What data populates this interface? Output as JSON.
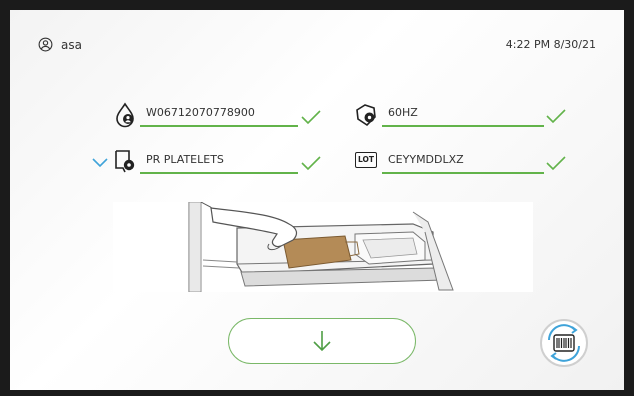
{
  "user": {
    "name": "asa",
    "icon": "user-circle-icon"
  },
  "clock": {
    "datetime": "4:22 PM 8/30/21"
  },
  "fields": {
    "donation_id": {
      "value": "W06712070778900",
      "icon": "donor-drop-icon"
    },
    "frequency": {
      "value": "60HZ",
      "icon": "hexagon-settings-icon"
    },
    "product": {
      "value": "PR PLATELETS",
      "icon": "bag-settings-icon"
    },
    "lot": {
      "value": "CEYYMDDLXZ",
      "icon_label": "LOT"
    }
  },
  "colors": {
    "accent_green": "#62b34a",
    "accent_blue": "#3fa3d9",
    "icon_dark": "#222222"
  },
  "actions": {
    "proceed": "down-arrow-icon",
    "scan": "barcode-scan-icon"
  }
}
